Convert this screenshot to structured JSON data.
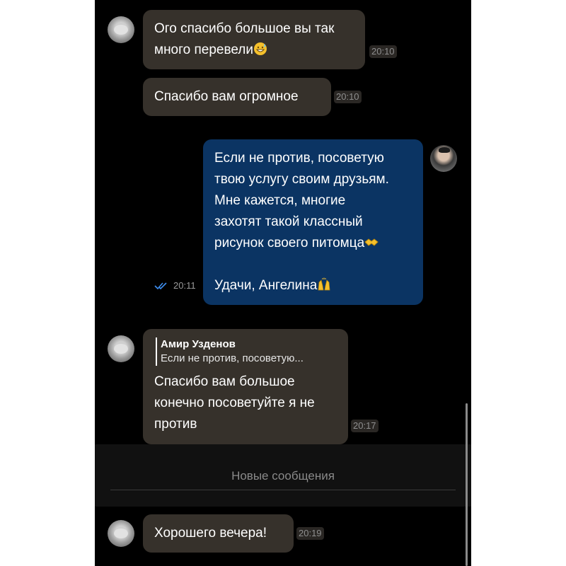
{
  "messages": [
    {
      "id": "m1",
      "lines": [
        "Ого спасибо большое вы так",
        "много перевели"
      ],
      "emoji": "grinning-sweat-emoji",
      "time": "20:10"
    },
    {
      "id": "m2",
      "lines": [
        "Спасибо вам  огромное"
      ],
      "time": "20:10"
    },
    {
      "id": "m3",
      "lines": [
        "Если не против, посоветую",
        "твою услугу своим друзьям.",
        "Мне кажется, многие",
        "захотят такой классный",
        "рисунок своего питомца",
        "",
        "Удачи, Ангелина"
      ],
      "emojis": [
        "handshake-emoji",
        "raised-hands-emoji"
      ],
      "time": "20:11",
      "status": "read"
    },
    {
      "id": "m4",
      "reply": {
        "name": "Амир Узденов",
        "text": "Если не против, посоветую..."
      },
      "lines": [
        "Спасибо вам большое",
        "конечно посоветуйте я не",
        "против"
      ],
      "time": "20:17"
    },
    {
      "id": "m5",
      "lines": [
        "Хорошего вечера!"
      ],
      "time": "20:19"
    }
  ],
  "separator": {
    "label": "Новые сообщения"
  },
  "colors": {
    "incoming_bubble": "#36312b",
    "outgoing_bubble": "#0b3463",
    "background": "#000000",
    "read_check": "#3d8ef0"
  }
}
